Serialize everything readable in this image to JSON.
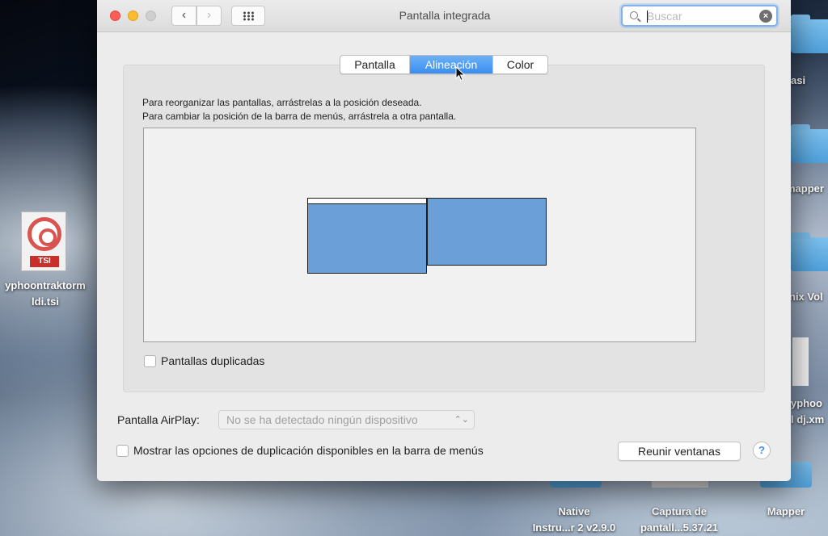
{
  "window": {
    "title": "Pantalla integrada",
    "back_icon": "‹",
    "forward_icon": "›"
  },
  "search": {
    "placeholder": "Buscar",
    "value": ""
  },
  "tabs": [
    {
      "label": "Pantalla",
      "selected": false
    },
    {
      "label": "Alineación",
      "selected": true
    },
    {
      "label": "Color",
      "selected": false
    }
  ],
  "arrangement": {
    "instruction_1": "Para reorganizar las pantallas, arrástrelas a la posición deseada.",
    "instruction_2": "Para cambiar la posición de la barra de menús, arrástrela a otra pantalla.",
    "mirror_label": "Pantallas duplicadas",
    "mirror_checked": false
  },
  "airplay": {
    "label": "Pantalla AirPlay:",
    "selected": "No se ha detectado ningún dispositivo"
  },
  "mirroring_options": {
    "label": "Mostrar las opciones de duplicación disponibles en la barra de menús",
    "checked": false
  },
  "gather_windows_label": "Reunir ventanas",
  "help_label": "?",
  "desktop": {
    "tsi_label_1": "yphoontraktorm",
    "tsi_label_2": "ldi.tsi",
    "tsi_tag": "TSI",
    "right_labels": [
      "asi",
      "mapper",
      "nix Vol",
      "yphoo",
      "l dj.xm"
    ],
    "bottom_items": [
      {
        "line1": "Native",
        "line2": "Instru...r 2 v2.9.0"
      },
      {
        "line1": "Captura de",
        "line2": "pantall...5.37.21"
      },
      {
        "line1": "Mapper",
        "line2": ""
      }
    ]
  },
  "colors": {
    "accent": "#3a8ef0",
    "screen_blue": "#6a9fd8"
  }
}
